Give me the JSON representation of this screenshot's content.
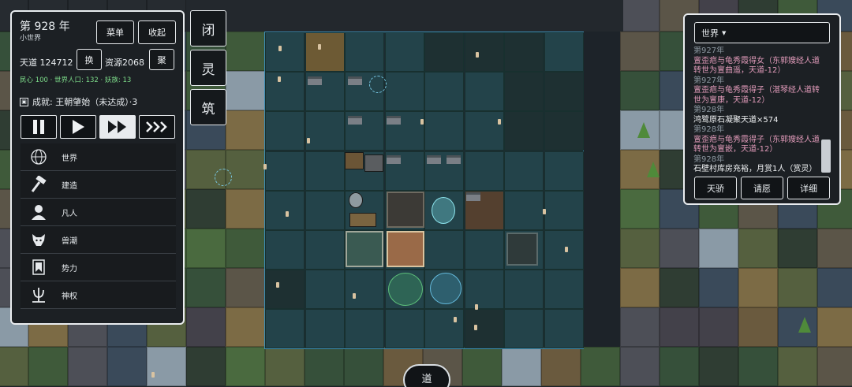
{
  "header": {
    "year_label": "第 928 年",
    "world_type": "小世界",
    "menu_button": "菜单",
    "collapse_button": "收起",
    "tiandao_label": "天道",
    "tiandao_value": "124712",
    "swap_button": "换",
    "resource_label": "资源",
    "resource_value": "2068",
    "gather_button": "聚",
    "substats": "民心 100 · 世界人口: 132 · 妖族: 13",
    "achievement": "成就: 王朝肇始（未达成）·3"
  },
  "menu": [
    {
      "label": "世界",
      "icon": "globe-icon"
    },
    {
      "label": "建造",
      "icon": "hammer-icon"
    },
    {
      "label": "凡人",
      "icon": "person-icon"
    },
    {
      "label": "兽潮",
      "icon": "wolf-icon"
    },
    {
      "label": "势力",
      "icon": "banner-icon"
    },
    {
      "label": "神权",
      "icon": "trident-icon"
    }
  ],
  "side_buttons": [
    "闭",
    "灵",
    "筑"
  ],
  "right_panel": {
    "selector": "世界",
    "log": [
      {
        "text": "第927年",
        "style": "year"
      },
      {
        "text": "亶歪疤与龟秀霞得女（东郭嫂经人道转世为亶曲遥，天道-12）",
        "style": "pink"
      },
      {
        "text": "第927年",
        "style": "year"
      },
      {
        "text": "亶歪疤与龟秀霞得子（湛琴经人道转世为亶康，天道-12）",
        "style": "pink"
      },
      {
        "text": "第928年",
        "style": "year"
      },
      {
        "text": "鸿鹭原石凝聚天道×574",
        "style": "white"
      },
      {
        "text": "第928年",
        "style": "year"
      },
      {
        "text": "亶歪疤与龟秀霞得子（东郭嫂经人道转世为亶嵌，天道-12）",
        "style": "pink"
      },
      {
        "text": "第928年",
        "style": "year"
      },
      {
        "text": "石壁村库房充裕，月赏1人（赏灵）",
        "style": "white"
      }
    ],
    "buttons": [
      "天骄",
      "请愿",
      "详细"
    ]
  },
  "bottom_button": "道",
  "colors": {
    "accent": "#3d8fb6",
    "panel_bg": "#1c2024",
    "pink_text": "#e09ab9",
    "green_text": "#7ddc8a"
  }
}
